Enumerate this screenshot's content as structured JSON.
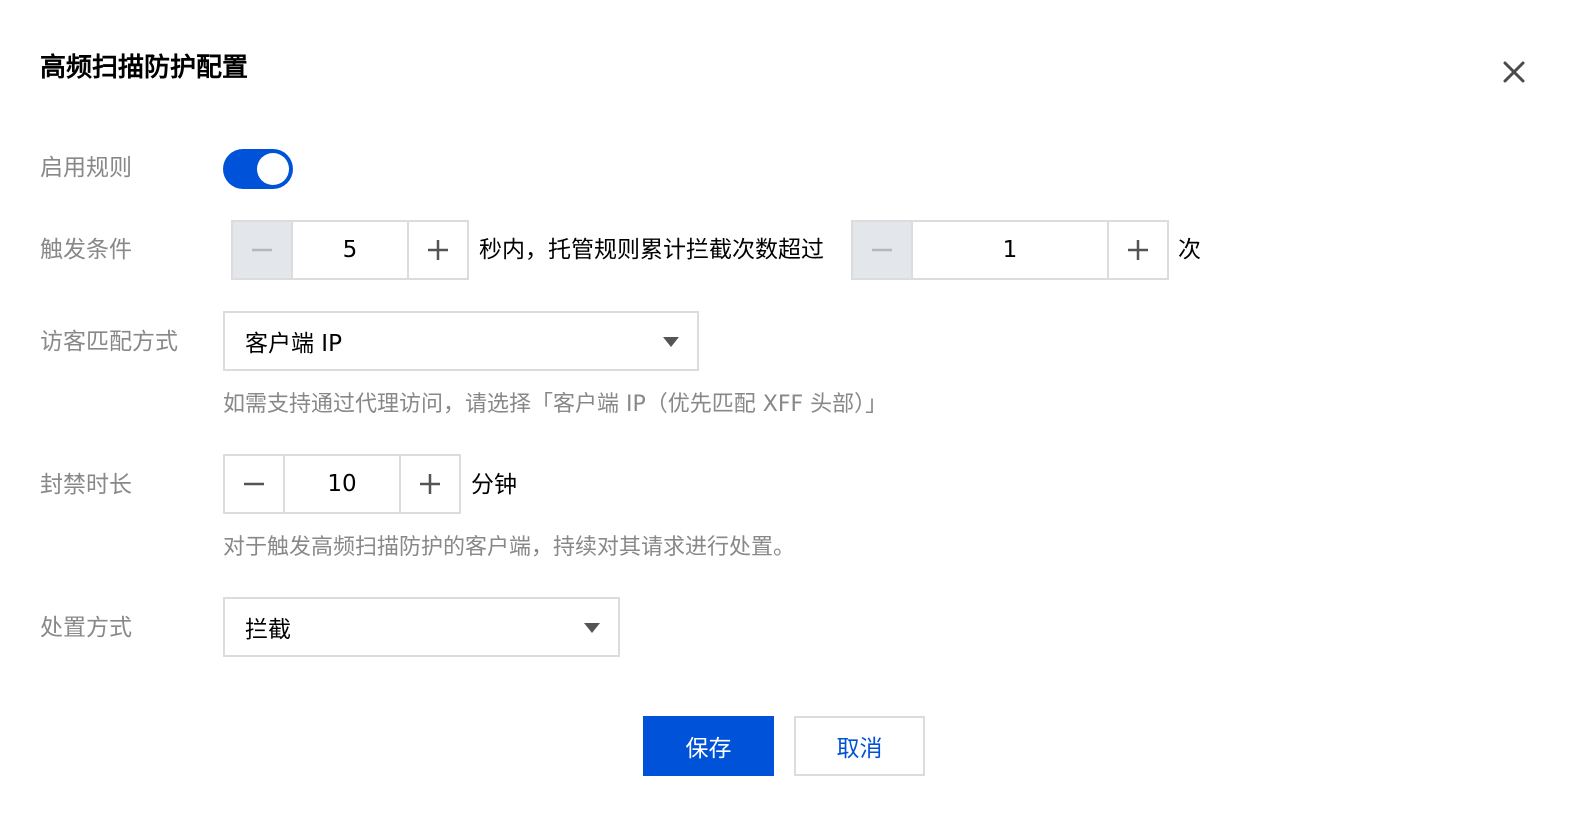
{
  "dialog": {
    "title": "高频扫描防护配置",
    "close_icon": "close-icon"
  },
  "colors": {
    "primary": "#0052d9",
    "label": "#888888",
    "border": "#dcdcdc",
    "disabled_bg": "#e3e6eb"
  },
  "enable_rule": {
    "label": "启用规则",
    "enabled": true
  },
  "trigger": {
    "label": "触发条件",
    "seconds_value": "5",
    "middle_text": "秒内，托管规则累计拦截次数超过",
    "count_value": "1",
    "suffix_text": "次"
  },
  "visitor_match": {
    "label": "访客匹配方式",
    "selected": "客户端 IP",
    "help": "如需支持通过代理访问，请选择「客户端 IP（优先匹配 XFF 头部）」"
  },
  "ban_duration": {
    "label": "封禁时长",
    "value": "10",
    "unit": "分钟",
    "help": "对于触发高频扫描防护的客户端，持续对其请求进行处置。"
  },
  "action": {
    "label": "处置方式",
    "selected": "拦截"
  },
  "footer": {
    "save_label": "保存",
    "cancel_label": "取消"
  }
}
